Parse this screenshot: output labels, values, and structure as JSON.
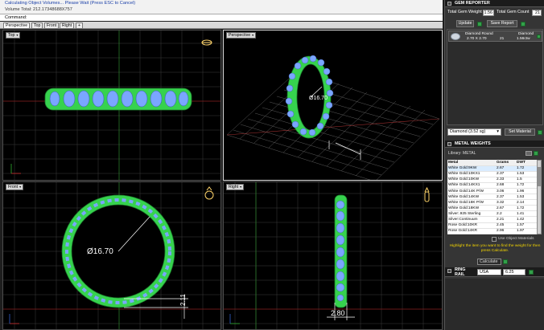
{
  "status": {
    "line1": "Calculating Object Volumes... Please Wait (Press ESC to Cancel)",
    "line2": "Volume Total: 212.17348688X757",
    "command_label": "Command:"
  },
  "viewport_tabs": [
    "Perspective",
    "Top",
    "Front",
    "Right",
    "+"
  ],
  "viewports": {
    "top": {
      "label": "Top"
    },
    "perspective": {
      "label": "Perspective",
      "dimension": "Ø16.70"
    },
    "front": {
      "label": "Front",
      "diameter": "Ø16.70",
      "height_dim": "2.11"
    },
    "right": {
      "label": "Right",
      "width_dim": "2.80"
    }
  },
  "gem_reporter": {
    "title": "GEM REPORTER",
    "total_weight_label": "Total Gem Weight",
    "total_weight_value": "1.56",
    "total_count_label": "Total Gem Count",
    "total_count_value": "21",
    "update_label": "Update",
    "save_report_label": "Save Report",
    "gem_row": {
      "col1_top": "Diamond Round",
      "col1_bottom": "2.70 X 2.70",
      "col2": "21",
      "col3_top": "Diamond",
      "col3_bottom": "1.56ctw"
    },
    "gem_select": "Diamond (3.52 sg)",
    "set_material_label": "Set Material"
  },
  "metal_weights": {
    "title": "METAL WEIGHTS",
    "library_label": "Library: METAL",
    "columns": [
      "Metal",
      "Grams",
      "DWT"
    ],
    "rows": [
      {
        "metal": "White Gold:9KW",
        "grams": "2.67",
        "dwt": "1.72"
      },
      {
        "metal": "White Gold:10KX1",
        "grams": "2.37",
        "dwt": "1.53"
      },
      {
        "metal": "White Gold:10KW",
        "grams": "2.33",
        "dwt": "1.5"
      },
      {
        "metal": "White Gold:14KX1",
        "grams": "2.68",
        "dwt": "1.72"
      },
      {
        "metal": "White Gold:14K P/W",
        "grams": "3.06",
        "dwt": "1.96"
      },
      {
        "metal": "White Gold:14KW",
        "grams": "2.37",
        "dwt": "1.53"
      },
      {
        "metal": "White Gold:18K P/W",
        "grams": "3.32",
        "dwt": "2.14"
      },
      {
        "metal": "White Gold:18KW",
        "grams": "2.67",
        "dwt": "1.72"
      },
      {
        "metal": "Silver:.925 Sterling",
        "grams": "2.2",
        "dwt": "1.41"
      },
      {
        "metal": "Silver:Continuum",
        "grams": "2.21",
        "dwt": "1.42"
      },
      {
        "metal": "Rose Gold:10KR",
        "grams": "2.45",
        "dwt": "1.57"
      },
      {
        "metal": "Rose Gold:14KR",
        "grams": "2.96",
        "dwt": "1.97"
      }
    ],
    "use_object_materials": "Use Object Materials",
    "hint": "Highlight the item you want to find the weight for then press Calculate.",
    "calculate_label": "Calculate"
  },
  "ring_rail": {
    "title": "RING RAIL",
    "region": "USA",
    "size": "6.25"
  },
  "colors": {
    "ring_green": "#36d24e",
    "gem_blue": "#7aa6ff",
    "grid": "#4c4c4c",
    "hint_yellow": "#f2d400",
    "accent_green": "#33a04a"
  }
}
